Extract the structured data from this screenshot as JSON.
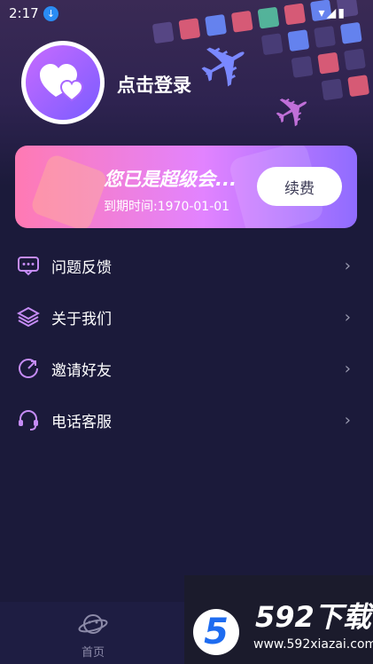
{
  "status_bar": {
    "time": "2:17"
  },
  "profile": {
    "login_text": "点击登录"
  },
  "vip": {
    "title": "您已是超级会...",
    "expire": "到期时间:1970-01-01",
    "renew_label": "续费"
  },
  "menu": {
    "items": [
      {
        "label": "问题反馈",
        "icon": "feedback-icon"
      },
      {
        "label": "关于我们",
        "icon": "layers-icon"
      },
      {
        "label": "邀请好友",
        "icon": "invite-icon"
      },
      {
        "label": "电话客服",
        "icon": "headset-icon"
      }
    ]
  },
  "bottom_nav": {
    "home_label": "首页"
  },
  "watermark": {
    "brand": "592下载",
    "url": "www.592xiazai.com",
    "logo_digit": "5"
  }
}
